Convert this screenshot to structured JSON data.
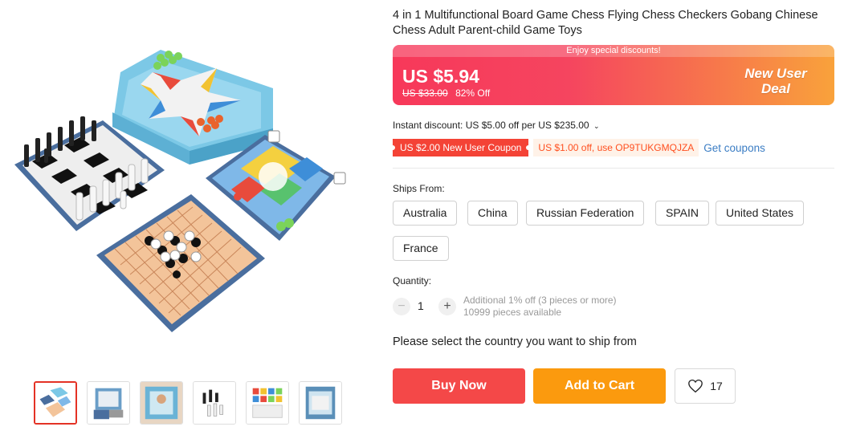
{
  "product": {
    "title": "4 in 1 Multifunctional Board Game Chess Flying Chess Checkers Gobang Chinese Chess Adult Parent-child Game Toys"
  },
  "gallery": {
    "thumbnail_count": 6,
    "selected_index": 0
  },
  "price": {
    "promo_strip": "Enjoy special discounts!",
    "current": "US $5.94",
    "original": "US $33.00",
    "discount": "82% Off",
    "badge": "New User Deal"
  },
  "discount": {
    "instant": "Instant discount: US $5.00 off per US $235.00",
    "chevron": "⌄"
  },
  "coupons": {
    "new_user": "US $2.00 New User Coupon",
    "code_offer": "US $1.00 off, use OP9TUKGMQJZA",
    "get_link": "Get coupons"
  },
  "shipping": {
    "label": "Ships From:",
    "options": [
      "Australia",
      "China",
      "Russian Federation",
      "SPAIN",
      "United States",
      "France"
    ]
  },
  "quantity": {
    "label": "Quantity:",
    "value": "1",
    "minus": "−",
    "plus": "+",
    "note_line1": "Additional 1% off (3 pieces or more)",
    "note_line2": "10999 pieces available"
  },
  "message": "Please select the country you want to ship from",
  "actions": {
    "buy_now": "Buy Now",
    "add_to_cart": "Add to Cart",
    "wishlist_count": "17"
  },
  "colors": {
    "accent_red": "#f44848",
    "accent_orange": "#fb9a0e",
    "link_blue": "#3b7dc4"
  }
}
